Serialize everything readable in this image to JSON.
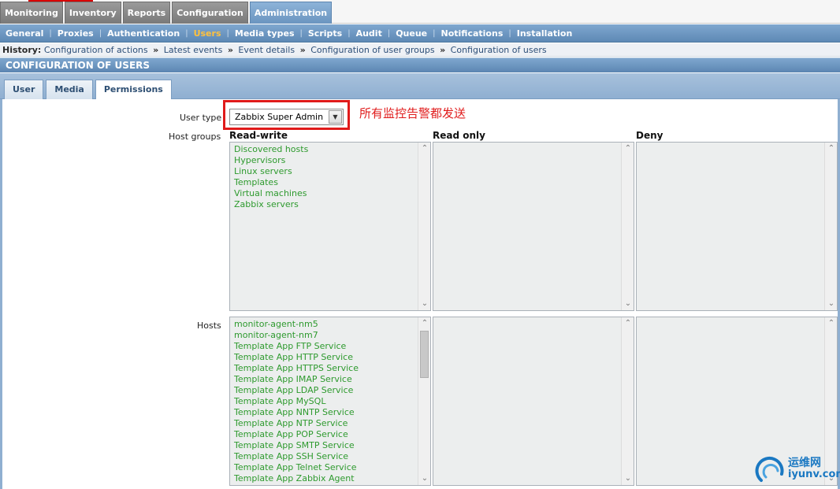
{
  "top_menu": [
    {
      "label": "Monitoring",
      "active": false
    },
    {
      "label": "Inventory",
      "active": false
    },
    {
      "label": "Reports",
      "active": false
    },
    {
      "label": "Configuration",
      "active": false
    },
    {
      "label": "Administration",
      "active": true
    }
  ],
  "sub_menu": [
    {
      "label": "General",
      "active": false
    },
    {
      "label": "Proxies",
      "active": false
    },
    {
      "label": "Authentication",
      "active": false
    },
    {
      "label": "Users",
      "active": true
    },
    {
      "label": "Media types",
      "active": false
    },
    {
      "label": "Scripts",
      "active": false
    },
    {
      "label": "Audit",
      "active": false
    },
    {
      "label": "Queue",
      "active": false
    },
    {
      "label": "Notifications",
      "active": false
    },
    {
      "label": "Installation",
      "active": false
    }
  ],
  "history": {
    "label": "History:",
    "separator": "»",
    "items": [
      "Configuration of actions",
      "Latest events",
      "Event details",
      "Configuration of user groups",
      "Configuration of users"
    ]
  },
  "section_title": "CONFIGURATION OF USERS",
  "tabs": [
    {
      "label": "User",
      "active": false
    },
    {
      "label": "Media",
      "active": false
    },
    {
      "label": "Permissions",
      "active": true
    }
  ],
  "form": {
    "user_type_label": "User type",
    "user_type_value": "Zabbix Super Admin",
    "annotation": "所有监控告警都发送",
    "host_groups_label": "Host groups",
    "hosts_label": "Hosts",
    "columns": [
      "Read-write",
      "Read only",
      "Deny"
    ],
    "host_groups_read_write": [
      "Discovered hosts",
      "Hypervisors",
      "Linux servers",
      "Templates",
      "Virtual machines",
      "Zabbix servers"
    ],
    "hosts_read_write": [
      "monitor-agent-nm5",
      "monitor-agent-nm7",
      "Template App FTP Service",
      "Template App HTTP Service",
      "Template App HTTPS Service",
      "Template App IMAP Service",
      "Template App LDAP Service",
      "Template App MySQL",
      "Template App NNTP Service",
      "Template App NTP Service",
      "Template App POP Service",
      "Template App SMTP Service",
      "Template App SSH Service",
      "Template App Telnet Service",
      "Template App Zabbix Agent"
    ]
  },
  "watermark": {
    "cn": "运维网",
    "en": "iyunv.com"
  },
  "colors": {
    "accent": "#e01b1b",
    "list_item": "#2e9a2e",
    "active_submenu": "#ffc13d"
  }
}
